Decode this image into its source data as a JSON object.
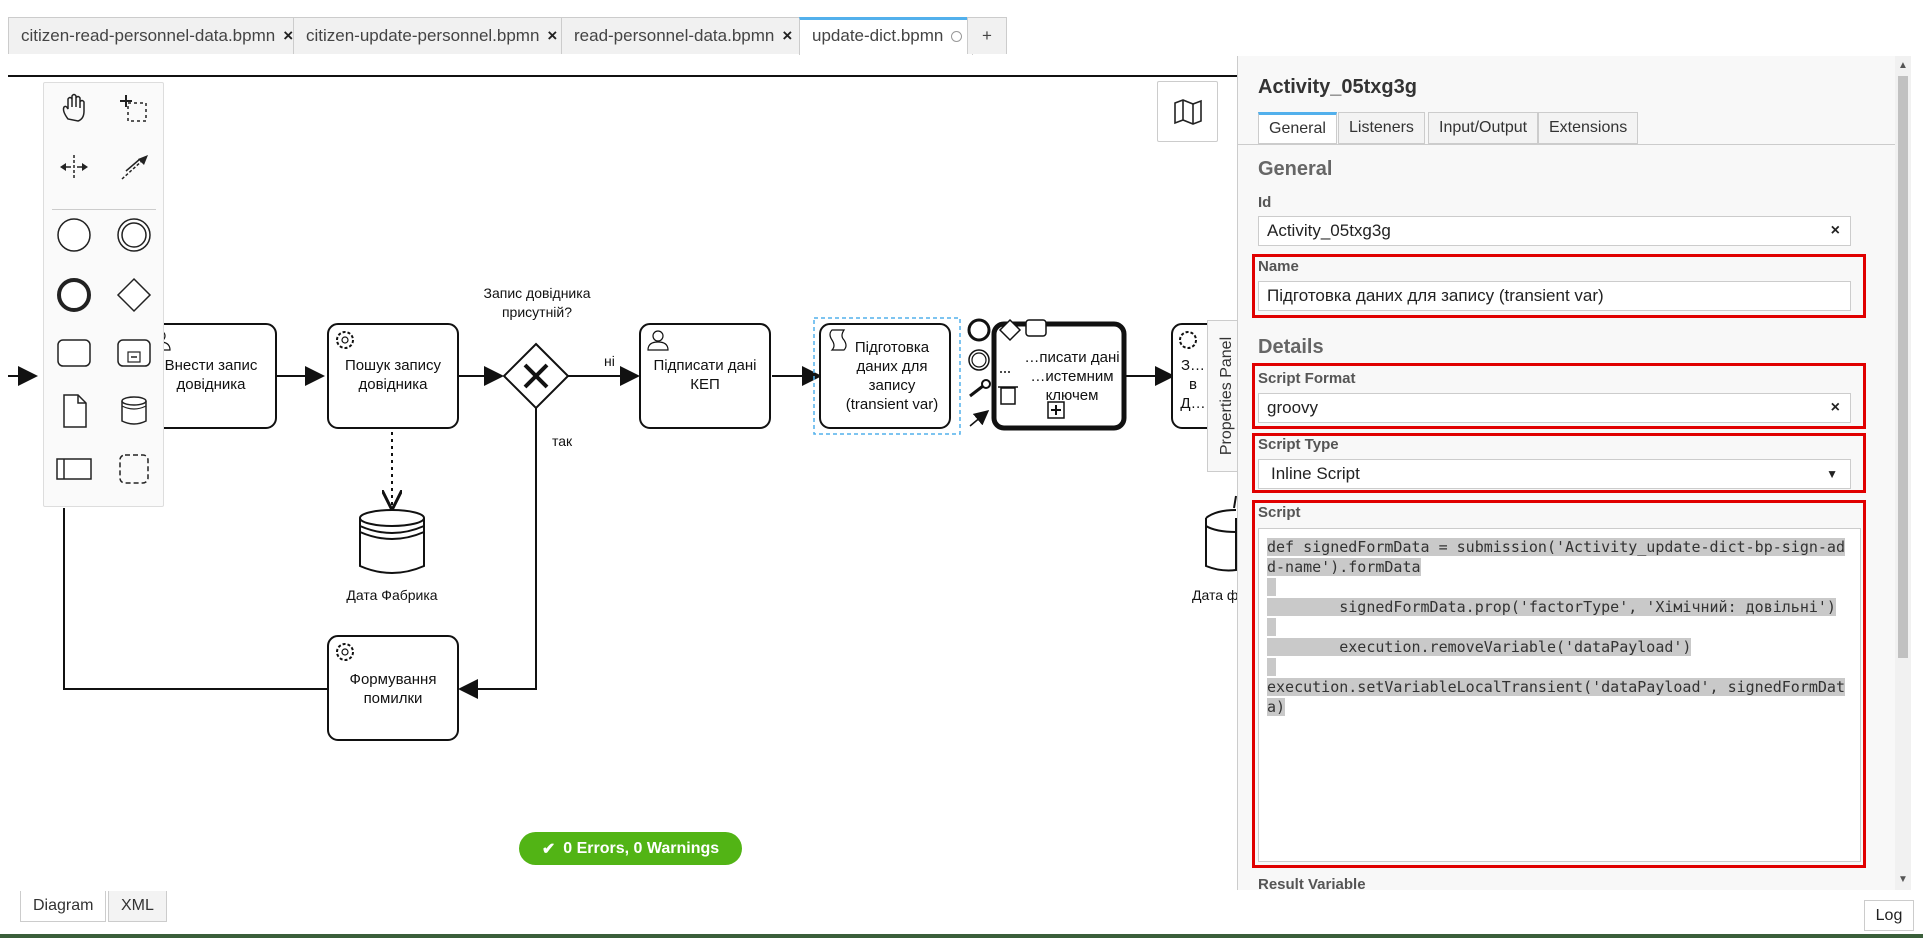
{
  "tabs": [
    {
      "label": "citizen-read-personnel-data.bpmn",
      "state": "close"
    },
    {
      "label": "citizen-update-personnel.bpmn",
      "state": "close"
    },
    {
      "label": "read-personnel-data.bpmn",
      "state": "close"
    },
    {
      "label": "update-dict.bpmn",
      "state": "unsaved"
    },
    {
      "label": "+",
      "state": "add"
    }
  ],
  "diagram": {
    "tasks": {
      "t1": "Внести запис довідника",
      "t2": "Пошук запису довідника",
      "t3": "Підписати дані КЕП",
      "t4": "Підготовка даних для запису (transient var)",
      "t5": "…писати дані …истемним ключем",
      "t6": "Формування помилки",
      "t7": "З… в Д…"
    },
    "gateway_label": "Запис довідника присутній?",
    "flow_no": "ні",
    "flow_yes": "так",
    "datastore1": "Дата Фабрика",
    "datastore2": "Дата ф…"
  },
  "status": {
    "text": "0 Errors, 0 Warnings",
    "color": "#52b415"
  },
  "properties_toggle": "Properties Panel",
  "bottom": {
    "diagram": "Diagram",
    "xml": "XML",
    "log": "Log"
  },
  "panel": {
    "title": "Activity_05txg3g",
    "tabs": [
      "General",
      "Listeners",
      "Input/Output",
      "Extensions"
    ],
    "general_header": "General",
    "id_label": "Id",
    "id_value": "Activity_05txg3g",
    "name_label": "Name",
    "name_value": "Підготовка даних для запису (transient var)",
    "details_header": "Details",
    "script_format_label": "Script Format",
    "script_format_value": "groovy",
    "script_type_label": "Script Type",
    "script_type_value": "Inline Script",
    "script_label": "Script",
    "script_lines": [
      "def signedFormData = submission('Activity_update-dict-bp-sign-add-name').formData",
      " ",
      "        signedFormData.prop('factorType', 'Хімічний: довільні')",
      " ",
      "        execution.removeVariable('dataPayload')",
      " ",
      "execution.setVariableLocalTransient('dataPayload', signedFormData)"
    ],
    "result_variable_label": "Result Variable"
  },
  "colors": {
    "accent": "#52b0ec",
    "highlight": "#e00000"
  }
}
